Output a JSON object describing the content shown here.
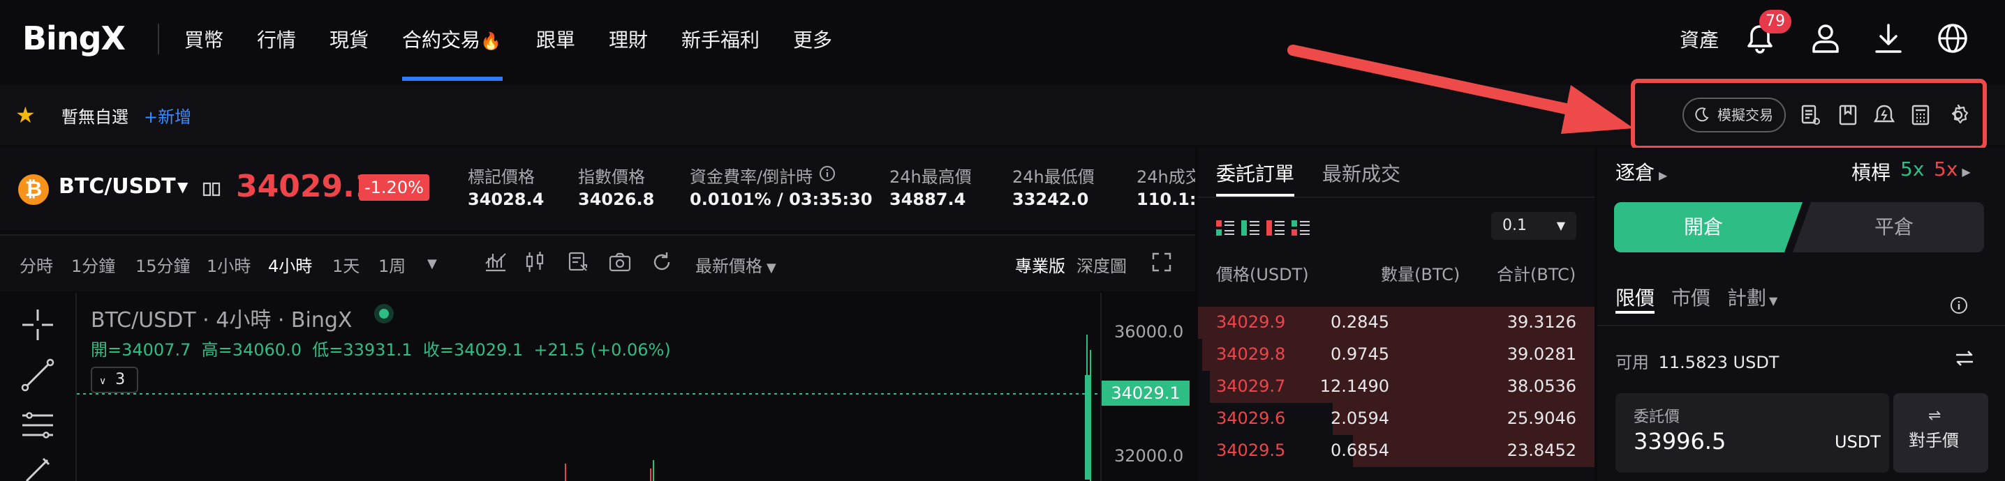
{
  "nav": {
    "logo": "BingX",
    "items": [
      "買幣",
      "行情",
      "現貨",
      "合約交易",
      "跟單",
      "理財",
      "新手福利",
      "更多"
    ],
    "active_index": 3,
    "assets": "資產",
    "notification_count": "79"
  },
  "favorites": {
    "empty_text": "暫無自選",
    "add_link": "+新增"
  },
  "toolbar": {
    "simulated_trade": "模擬交易"
  },
  "ticker": {
    "pair": "BTC/USDT",
    "last_price": "34029.1",
    "change_pct": "-1.20%",
    "stats": [
      {
        "label": "標記價格",
        "value": "34028.4"
      },
      {
        "label": "指數價格",
        "value": "34026.8"
      },
      {
        "label": "資金費率/倒計時",
        "value": "0.0101% / 03:35:30"
      },
      {
        "label": "24h最高價",
        "value": "34887.4"
      },
      {
        "label": "24h最低價",
        "value": "33242.0"
      },
      {
        "label": "24h成交",
        "value": "110.1:"
      }
    ]
  },
  "chart_toolbar": {
    "timeframes": [
      "分時",
      "1分鐘",
      "15分鐘",
      "1小時",
      "4小時",
      "1天",
      "1周"
    ],
    "active_timeframe_index": 4,
    "price_type": "最新價格",
    "pro_label": "專業版",
    "depth_label": "深度圖"
  },
  "chart": {
    "title": "BTC/USDT · 4小時 · BingX",
    "ohlc": "開=34007.7  高=34060.0  低=33931.1  收=34029.1  +21.5 (+0.06%)",
    "indicator_count": "3",
    "y_ticks": [
      "36000.0",
      "32000.0"
    ],
    "current_price_tag": "34029.1",
    "colors": {
      "up": "#20b26c",
      "down": "#ef454a",
      "accent": "#2ebd85"
    }
  },
  "orderbook": {
    "tabs": [
      "委託訂單",
      "最新成交"
    ],
    "precision": "0.1",
    "headers": [
      "價格(USDT)",
      "數量(BTC)",
      "合計(BTC)"
    ],
    "asks": [
      {
        "price": "34029.9",
        "qty": "0.2845",
        "total": "39.3126",
        "depth": 1.0
      },
      {
        "price": "34029.8",
        "qty": "0.9745",
        "total": "39.0281",
        "depth": 0.99
      },
      {
        "price": "34029.7",
        "qty": "12.1490",
        "total": "38.0536",
        "depth": 0.97
      },
      {
        "price": "34029.6",
        "qty": "2.0594",
        "total": "25.9046",
        "depth": 0.66
      },
      {
        "price": "34029.5",
        "qty": "0.6854",
        "total": "23.8452",
        "depth": 0.61
      }
    ]
  },
  "trade": {
    "margin_mode": "逐倉",
    "leverage_label": "槓桿",
    "long_leverage": "5x",
    "short_leverage": "5x",
    "open_label": "開倉",
    "close_label": "平倉",
    "order_types": [
      "限價",
      "市價",
      "計劃"
    ],
    "available_label": "可用",
    "available_value": "11.5823 USDT",
    "price_field_label": "委託價",
    "price_field_value": "33996.5",
    "price_unit": "USDT",
    "counterparty_label": "對手價"
  }
}
